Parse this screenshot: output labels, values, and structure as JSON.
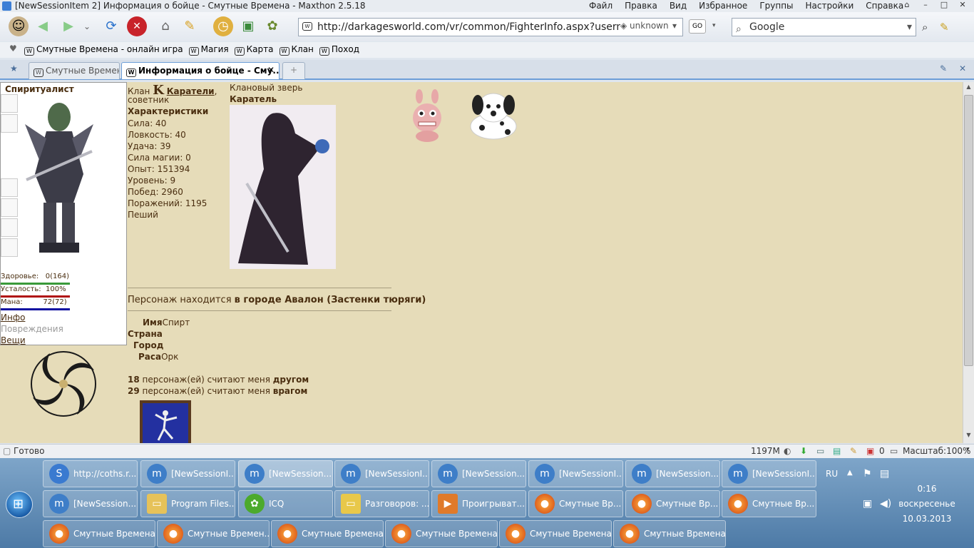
{
  "window": {
    "title": "[NewSessionItem 2] Информация о бойце - Смутные Времена - Maxthon 2.5.18",
    "menu": [
      "Файл",
      "Правка",
      "Вид",
      "Избранное",
      "Группы",
      "Настройки",
      "Справка"
    ]
  },
  "toolbar": {
    "url": "http://darkagesworld.com/vr/common/FighterInfo.aspx?username='",
    "security": "unknown",
    "go": "GO",
    "search_placeholder": "Google"
  },
  "bookmarks": [
    "Смутные Времена - онлайн игра",
    "Магия",
    "Карта",
    "Клан",
    "Поход"
  ],
  "tabs": [
    "Смутные Времена",
    "Информация о бойце - Сму..."
  ],
  "fighter": {
    "class": "Спиритуалист",
    "health_label": "Здоровье:",
    "health_value": "0(164)",
    "fatigue_label": "Усталость:",
    "fatigue_value": "100%",
    "mana_label": "Мана:",
    "mana_value": "72(72)",
    "links": [
      "Инфо",
      "Повреждения",
      "Вещи"
    ],
    "clan_label": "Клан",
    "clan_mark": "K",
    "clan_name": "Каратели",
    "clan_name_comma": ",",
    "clan_rank": "советник",
    "stats_title": "Характеристики",
    "stats": [
      "Сила: 40",
      "Ловкость: 40",
      "Удача: 39",
      "Сила магии: 0",
      "Опыт: 151394",
      "Уровень: 9",
      "Побед: 2960",
      "Поражений: 1195",
      "Пеший"
    ],
    "beast_label": "Клановый зверь",
    "beast_name": "Каратель",
    "location_prefix": "Персонаж находится ",
    "location": "в городе Авалон (Застенки тюряги)",
    "name_label": "Имя",
    "name_value": "Спирт",
    "country_label": "Страна",
    "city_label": "Город",
    "race_label": "Раса",
    "race_value": "Орк",
    "friends_count": "18",
    "friends_text": " персонаж(ей) считают меня ",
    "friends_word": "другом",
    "enemies_count": "29",
    "enemies_text": " персонаж(ей) считают меня ",
    "enemies_word": "врагом"
  },
  "statusbar": {
    "text": "Готово",
    "memory": "1197M",
    "count": "0",
    "zoom": "Масштаб:100%"
  },
  "taskbar": {
    "row1": [
      "http://coths.r...",
      "[NewSessionI...",
      "[NewSession...",
      "[NewSessionI...",
      "[NewSession...",
      "[NewSessionI...",
      "[NewSession...",
      "[NewSessionI..."
    ],
    "row2": [
      "[NewSession...",
      "Program Files...",
      "ICQ",
      "Разговоров: ...",
      "Проигрыват...",
      "Смутные Вр...",
      "Смутные Вр...",
      "Смутные Вр..."
    ],
    "row3": [
      "Смутные Времена...",
      "Смутные Времен...",
      "Смутные Времена...",
      "Смутные Времена...",
      "Смутные Времена...",
      "Смутные Времена..."
    ],
    "lang": "RU",
    "time": "0:16",
    "day": "воскресенье",
    "date": "10.03.2013"
  },
  "colors": {
    "page_bg": "#e6dcb9",
    "text": "#4a2e10",
    "health_bar": "#3a9a3a",
    "fatigue_bar": "#b01010",
    "mana_bar": "#1010a0",
    "tab_accent": "#6d9ed8"
  }
}
